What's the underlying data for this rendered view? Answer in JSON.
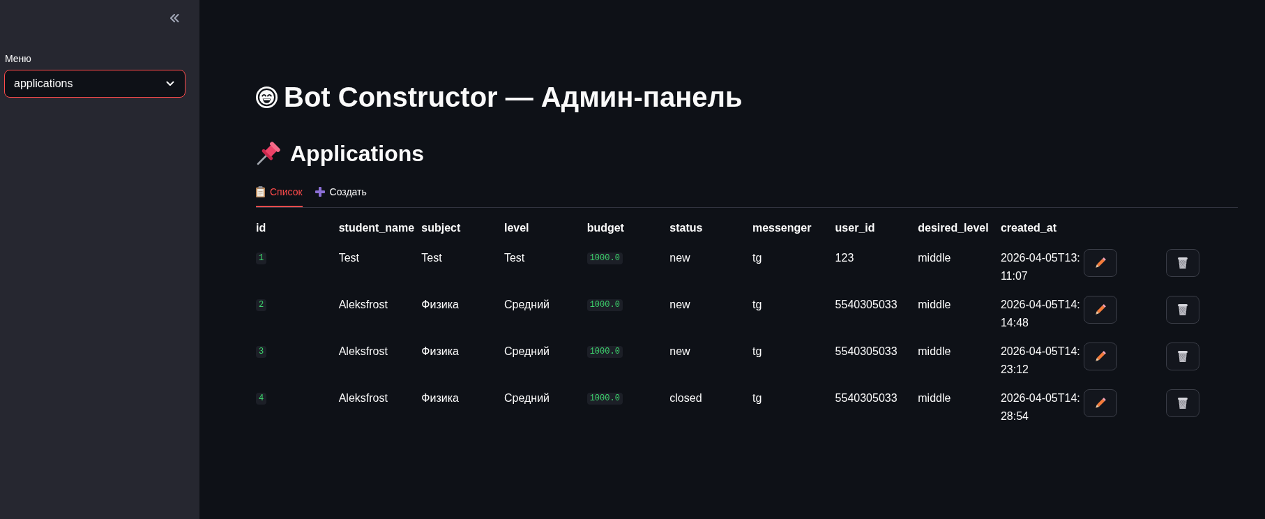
{
  "sidebar": {
    "menu": {
      "label": "Меню",
      "value": "applications"
    }
  },
  "header": {
    "title": "Bot Constructor — Админ-панель"
  },
  "section": {
    "title": "Applications",
    "tabs": [
      {
        "label": "Список",
        "selected": true
      },
      {
        "label": "Создать",
        "selected": false
      }
    ]
  },
  "table": {
    "columns": [
      {
        "label": "id",
        "kind": "code"
      },
      {
        "label": "student_name",
        "kind": "text"
      },
      {
        "label": "subject",
        "kind": "text"
      },
      {
        "label": "level",
        "kind": "text"
      },
      {
        "label": "budget",
        "kind": "code"
      },
      {
        "label": "status",
        "kind": "text"
      },
      {
        "label": "messenger",
        "kind": "text"
      },
      {
        "label": "user_id",
        "kind": "text"
      },
      {
        "label": "desired_level",
        "kind": "text"
      },
      {
        "label": "created_at",
        "kind": "text"
      }
    ],
    "rows": [
      {
        "cells": [
          "1",
          "Test",
          "Test",
          "Test",
          "1000.0",
          "new",
          "tg",
          "123",
          "middle",
          "2026-04-05T13:11:07"
        ]
      },
      {
        "cells": [
          "2",
          "Aleksfrost",
          "Физика",
          "Средний",
          "1000.0",
          "new",
          "tg",
          "5540305033",
          "middle",
          "2026-04-05T14:14:48"
        ]
      },
      {
        "cells": [
          "3",
          "Aleksfrost",
          "Физика",
          "Средний",
          "1000.0",
          "new",
          "tg",
          "5540305033",
          "middle",
          "2026-04-05T14:23:12"
        ]
      },
      {
        "cells": [
          "4",
          "Aleksfrost",
          "Физика",
          "Средний",
          "1000.0",
          "closed",
          "tg",
          "5540305033",
          "middle",
          "2026-04-05T14:28:54"
        ]
      }
    ]
  }
}
